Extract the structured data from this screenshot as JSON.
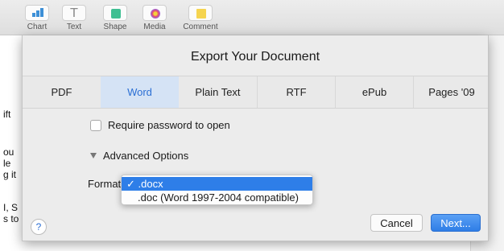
{
  "toolbar": {
    "items": [
      {
        "label": "Chart",
        "icon": "chart-icon"
      },
      {
        "label": "Text",
        "icon": "text-icon"
      },
      {
        "label": "Shape",
        "icon": "shape-icon"
      },
      {
        "label": "Media",
        "icon": "media-icon"
      },
      {
        "label": "Comment",
        "icon": "comment-icon"
      }
    ],
    "text_glyph": "T"
  },
  "document": {
    "fragments": [
      "ift",
      "ou",
      "le",
      "g it",
      "I, S",
      "s to"
    ]
  },
  "dialog": {
    "title": "Export Your Document",
    "tabs": [
      {
        "label": "PDF",
        "active": false
      },
      {
        "label": "Word",
        "active": true
      },
      {
        "label": "Plain Text",
        "active": false
      },
      {
        "label": "RTF",
        "active": false
      },
      {
        "label": "ePub",
        "active": false
      },
      {
        "label": "Pages '09",
        "active": false
      }
    ],
    "require_password_label": "Require password to open",
    "require_password_checked": false,
    "advanced_options_label": "Advanced Options",
    "format_label": "Format",
    "format_menu": {
      "options": [
        ".docx",
        ".doc (Word 1997-2004 compatible)"
      ],
      "selected_mark": "✓",
      "selected_index": 0
    },
    "help_label": "?",
    "cancel_label": "Cancel",
    "next_label": "Next..."
  },
  "colors": {
    "accent": "#2e7ee8",
    "active_tab_bg": "#d5e3f5",
    "active_tab_text": "#2b6fd4"
  }
}
